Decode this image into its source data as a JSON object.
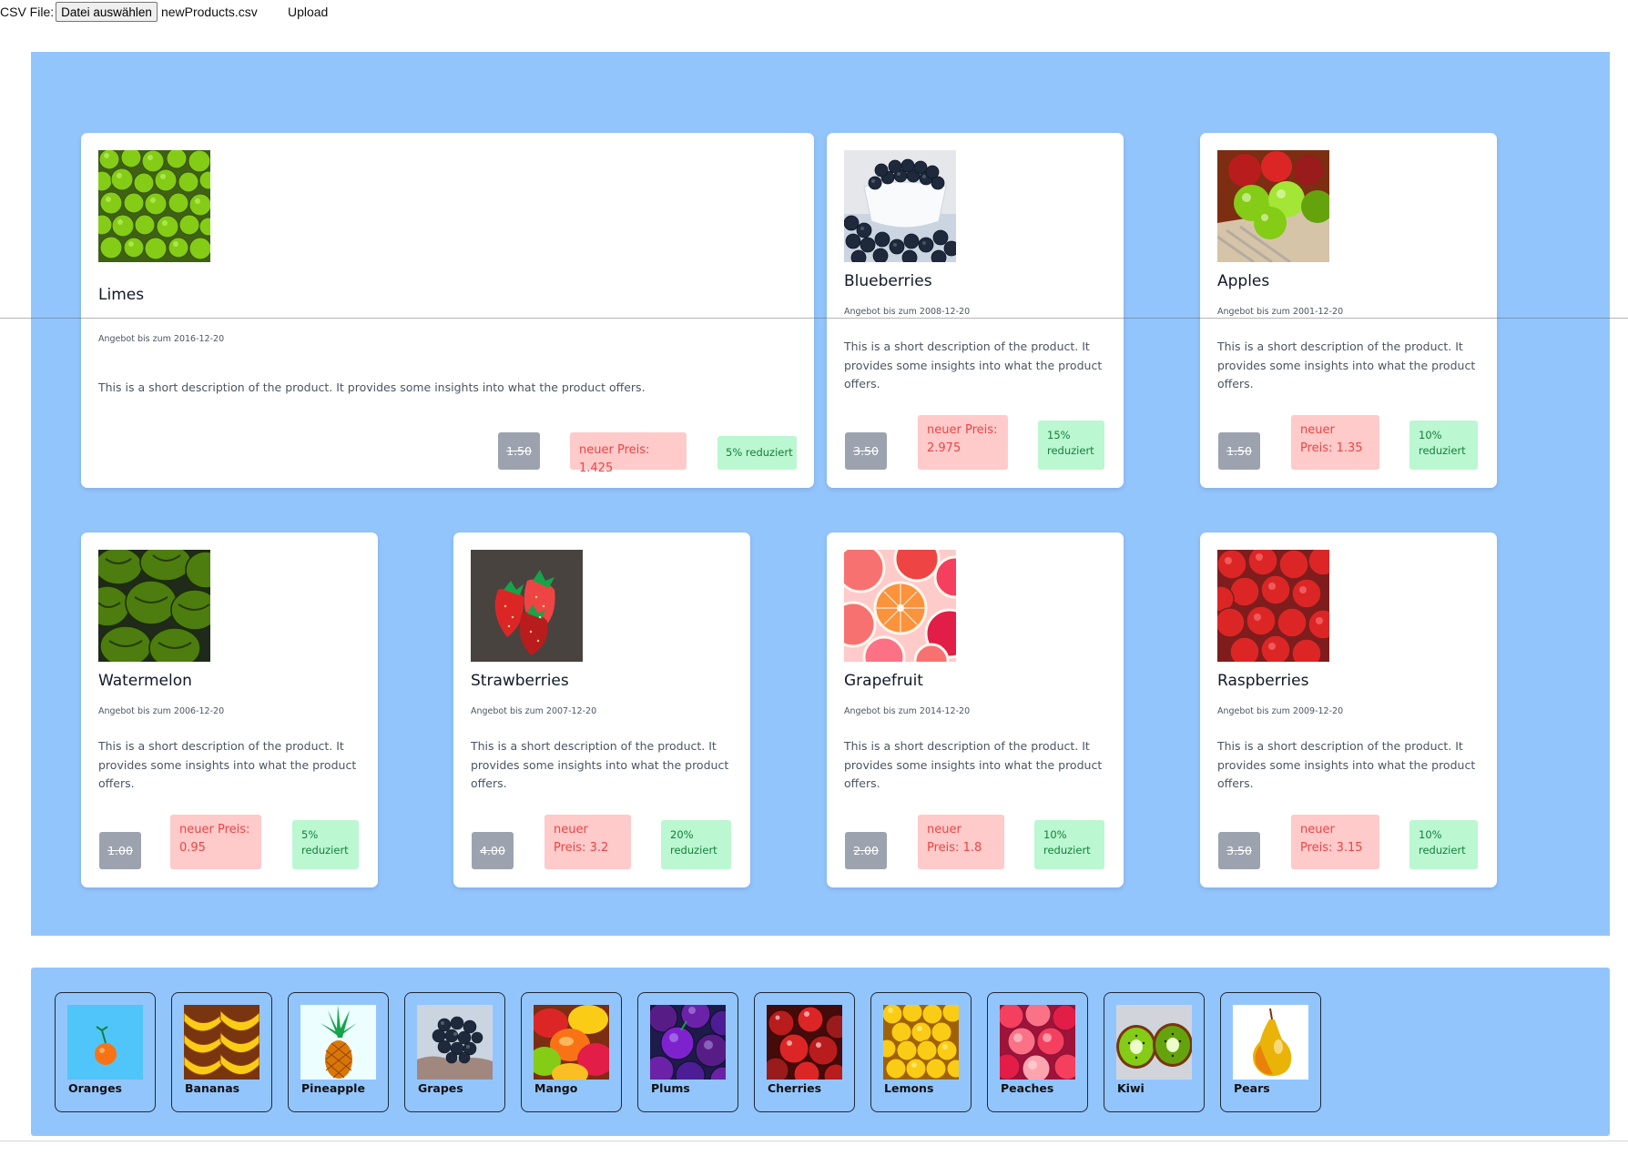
{
  "upload": {
    "label": "CSV File:",
    "choose_button": "Datei auswählen",
    "file_name": "newProducts.csv",
    "upload_button": "Upload"
  },
  "products": [
    {
      "name": "Limes",
      "image": "limes-image",
      "offer": "Angebot bis zum 2016-12-20",
      "description": "This is a short description of the product. It provides some insights into what the product offers.",
      "old_price": "1.50",
      "new_price": "neuer Preis: 1.425",
      "discount": "5% reduziert"
    },
    {
      "name": "Blueberries",
      "image": "blueberries-image",
      "offer": "Angebot bis zum 2008-12-20",
      "description": "This is a short description of the product. It provides some insights into what the product offers.",
      "old_price": "3.50",
      "new_price": "neuer Preis: 2.975",
      "discount": "15% reduziert"
    },
    {
      "name": "Apples",
      "image": "apples-image",
      "offer": "Angebot bis zum 2001-12-20",
      "description": "This is a short description of the product. It provides some insights into what the product offers.",
      "old_price": "1.50",
      "new_price": "neuer Preis: 1.35",
      "discount": "10% reduziert"
    },
    {
      "name": "Watermelon",
      "image": "watermelon-image",
      "offer": "Angebot bis zum 2006-12-20",
      "description": "This is a short description of the product. It provides some insights into what the product offers.",
      "old_price": "1.00",
      "new_price": "neuer Preis: 0.95",
      "discount": "5% reduziert"
    },
    {
      "name": "Strawberries",
      "image": "strawberries-image",
      "offer": "Angebot bis zum 2007-12-20",
      "description": "This is a short description of the product. It provides some insights into what the product offers.",
      "old_price": "4.00",
      "new_price": "neuer Preis: 3.2",
      "discount": "20% reduziert"
    },
    {
      "name": "Grapefruit",
      "image": "grapefruit-image",
      "offer": "Angebot bis zum 2014-12-20",
      "description": "This is a short description of the product. It provides some insights into what the product offers.",
      "old_price": "2.00",
      "new_price": "neuer Preis: 1.8",
      "discount": "10% reduziert"
    },
    {
      "name": "Raspberries",
      "image": "raspberries-image",
      "offer": "Angebot bis zum 2009-12-20",
      "description": "This is a short description of the product. It provides some insights into what the product offers.",
      "old_price": "3.50",
      "new_price": "neuer Preis: 3.15",
      "discount": "10% reduziert"
    }
  ],
  "catalog": [
    {
      "name": "Oranges",
      "image": "oranges-image"
    },
    {
      "name": "Bananas",
      "image": "bananas-image"
    },
    {
      "name": "Pineapple",
      "image": "pineapple-image"
    },
    {
      "name": "Grapes",
      "image": "grapes-image"
    },
    {
      "name": "Mango",
      "image": "mango-image"
    },
    {
      "name": "Plums",
      "image": "plums-image"
    },
    {
      "name": "Cherries",
      "image": "cherries-image"
    },
    {
      "name": "Lemons",
      "image": "lemons-image"
    },
    {
      "name": "Peaches",
      "image": "peaches-image"
    },
    {
      "name": "Kiwi",
      "image": "kiwi-image"
    },
    {
      "name": "Pears",
      "image": "pears-image"
    }
  ],
  "colors": {
    "panel": "#93c5fd",
    "old_price_bg": "#9ca3af",
    "new_price_bg": "#fecaca",
    "new_price_text": "#ef4444",
    "discount_bg": "#bbf7d0",
    "discount_text": "#15803d"
  }
}
